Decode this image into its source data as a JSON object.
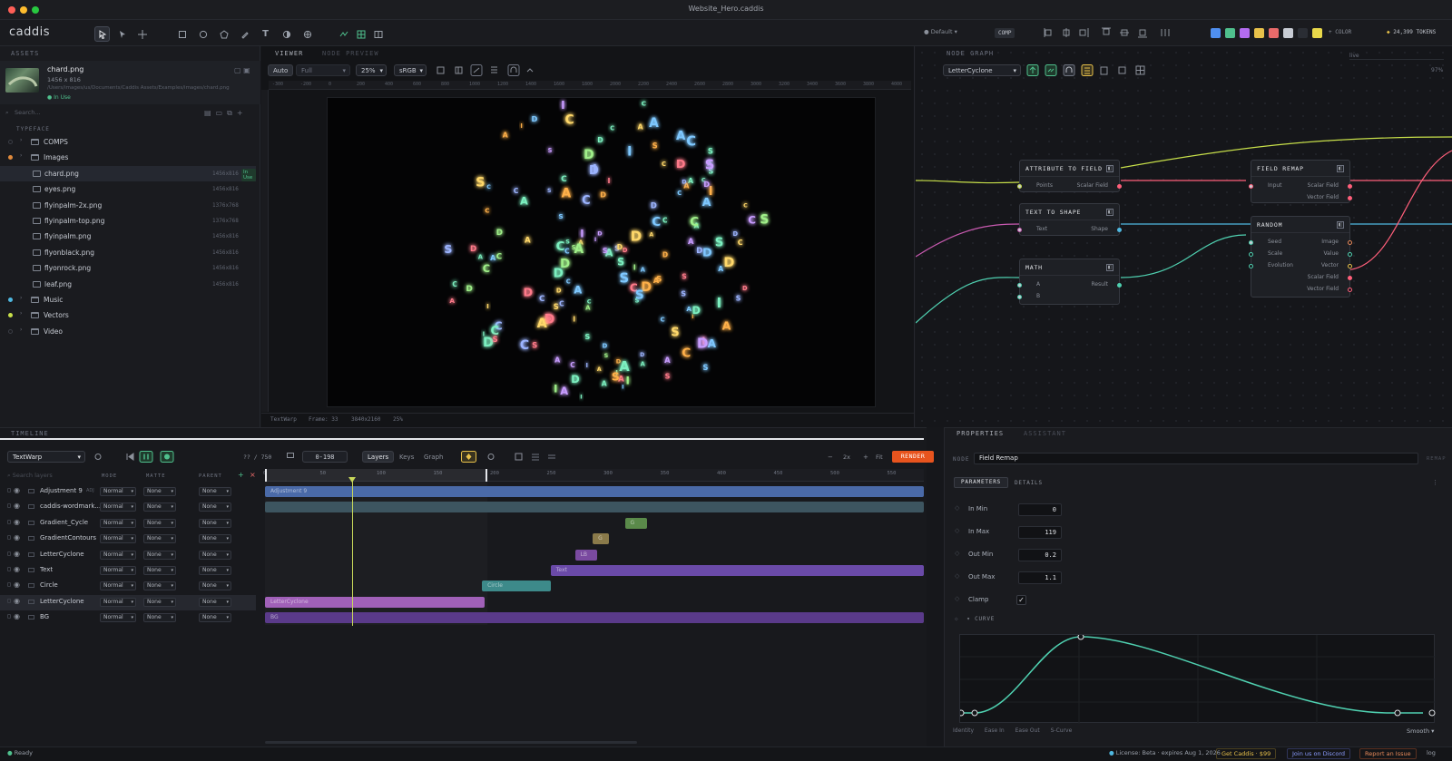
{
  "window": {
    "title": "Website_Hero.caddis"
  },
  "app": {
    "logo": "caddis"
  },
  "toolbar": {
    "tools": [
      "select-icon",
      "pointer-icon",
      "move-icon",
      "rectangle-icon",
      "ellipse-icon",
      "polygon-icon",
      "pen-icon",
      "text-icon",
      "mask-icon",
      "anchor-icon",
      "graph-icon",
      "grid-icon",
      "split-icon"
    ],
    "workspace": "Default",
    "comp_label": "COMP",
    "color_label": "+ COLOR",
    "tokens": "24,399 TOKENS",
    "swatches": [
      "#4f8ff0",
      "#4fc08d",
      "#b46cf0",
      "#e8c14a",
      "#e86a6a",
      "#c8ccd4",
      "#2a2d34",
      "#e8d84a"
    ]
  },
  "assets": {
    "header": "ASSETS",
    "preview": {
      "name": "chard.png",
      "size": "1456 x 816",
      "path": "/Users/images/us/Documents/Caddis Assets/Examples/images/chard.png",
      "status": "In Use"
    },
    "search_placeholder": "Search...",
    "section": "TYPEFACE",
    "items": [
      {
        "label": "COMPS",
        "type": "folder",
        "dot": "",
        "indent": 0
      },
      {
        "label": "Images",
        "type": "folder",
        "dot": "#e08a3c",
        "indent": 0
      },
      {
        "label": "chard.png",
        "type": "file",
        "dim": "1456x816",
        "badge": "In Use",
        "indent": 1,
        "selected": true
      },
      {
        "label": "eyes.png",
        "type": "file",
        "dim": "1456x816",
        "indent": 1
      },
      {
        "label": "flyinpalm-2x.png",
        "type": "file",
        "dim": "1376x768",
        "indent": 1
      },
      {
        "label": "flyinpalm-top.png",
        "type": "file",
        "dim": "1376x768",
        "indent": 1
      },
      {
        "label": "flyinpalm.png",
        "type": "file",
        "dim": "1456x816",
        "indent": 1
      },
      {
        "label": "flyonblack.png",
        "type": "file",
        "dim": "1456x816",
        "indent": 1
      },
      {
        "label": "flyonrock.png",
        "type": "file",
        "dim": "1456x816",
        "indent": 1
      },
      {
        "label": "leaf.png",
        "type": "file",
        "dim": "1456x816",
        "indent": 1
      },
      {
        "label": "Music",
        "type": "folder",
        "dot": "#4fb8e0",
        "indent": 0
      },
      {
        "label": "Vectors",
        "type": "folder",
        "dot": "#c8e04a",
        "indent": 0
      },
      {
        "label": "Video",
        "type": "folder",
        "dot": "",
        "indent": 0
      }
    ]
  },
  "viewer": {
    "tabs": [
      "VIEWER",
      "NODE PREVIEW"
    ],
    "controls": {
      "auto": "Auto",
      "quality": "Full",
      "zoom": "25%",
      "colorspace": "sRGB"
    },
    "ruler": [
      "-300",
      "-200",
      "0",
      "200",
      "400",
      "600",
      "800",
      "1000",
      "1200",
      "1400",
      "1600",
      "1800",
      "2000",
      "2200",
      "2400",
      "2600",
      "2800",
      "3000",
      "3200",
      "3400",
      "3600",
      "3800",
      "4000"
    ],
    "footer": {
      "comp": "TextWarp",
      "frame": "Frame: 33",
      "res": "3840x2160",
      "zoom": "25%"
    },
    "letters": "ACDISACDSACIACDSACDSACIDCSAIDSACDSAIDCACDSAICDSAISACDSAICDSACDSICASDCAIDSACDSACIDSAICDSACDSAIDSACDSACDISACDSACIDSACDSAIDCSADCIASDCAIDSACDSAICDSACDSAIDCSACDSAICDS",
    "letter_colors": [
      "#7ec8ff",
      "#ffd86a",
      "#c89cff",
      "#7cf0c0",
      "#ff7a8a",
      "#a0f08a",
      "#ffb04a",
      "#9cb4ff"
    ]
  },
  "node_graph": {
    "header": "NODE GRAPH",
    "selector": "LetterCyclone",
    "live": "live",
    "zoom": "97%",
    "nodes": {
      "attr": {
        "title": "ATTRIBUTE TO FIELD",
        "in": [
          "Points"
        ],
        "out": [
          "Scalar Field"
        ]
      },
      "text": {
        "title": "TEXT TO SHAPE",
        "in": [
          "Text"
        ],
        "out": [
          "Shape"
        ]
      },
      "math": {
        "title": "MATH",
        "in": [
          "A",
          "B"
        ],
        "out": [
          "Result"
        ]
      },
      "remap": {
        "title": "FIELD REMAP",
        "in": [
          "Input"
        ],
        "out": [
          "Scalar Field",
          "Vector Field"
        ]
      },
      "random": {
        "title": "RANDOM",
        "in": [
          "Seed",
          "Scale",
          "Evolution"
        ],
        "out": [
          "Image",
          "Value",
          "Vector",
          "Scalar Field",
          "Vector Field"
        ]
      }
    }
  },
  "timeline": {
    "header": "TIMELINE",
    "comp": "TextWarp",
    "frame": "?? / 750",
    "range": "0-198",
    "modes": [
      "Layers",
      "Keys",
      "Graph"
    ],
    "speed": "2x",
    "fit": "Fit",
    "render": "RENDER",
    "search_placeholder": "Search layers",
    "columns": [
      "MODE",
      "MATTE",
      "PARENT"
    ],
    "ticks": [
      "0",
      "50",
      "100",
      "150",
      "200",
      "250",
      "300",
      "350",
      "400",
      "450",
      "500",
      "550"
    ],
    "layers": [
      {
        "name": "Adjustment 9",
        "tag": "ADJ",
        "mode": "Normal",
        "matte": "None",
        "parent": "None"
      },
      {
        "name": "caddis-wordmark...",
        "mode": "Normal",
        "matte": "None",
        "parent": "None"
      },
      {
        "name": "Gradient_Cycle",
        "mode": "Normal",
        "matte": "None",
        "parent": "None"
      },
      {
        "name": "GradientContours",
        "mode": "Normal",
        "matte": "None",
        "parent": "None"
      },
      {
        "name": "LetterCyclone",
        "mode": "Normal",
        "matte": "None",
        "parent": "None"
      },
      {
        "name": "Text",
        "mode": "Normal",
        "matte": "None",
        "parent": "None"
      },
      {
        "name": "Circle",
        "mode": "Normal",
        "matte": "None",
        "parent": "None"
      },
      {
        "name": "LetterCyclone",
        "mode": "Normal",
        "matte": "None",
        "parent": "None",
        "selected": true
      },
      {
        "name": "BG",
        "mode": "Normal",
        "matte": "None",
        "parent": "None"
      }
    ],
    "clips": [
      {
        "label": "Adjustment 9",
        "color": "#4a6aa8"
      },
      {
        "label": "",
        "color": "#3d5560"
      },
      {
        "label": "G",
        "color": "#5a8a4a"
      },
      {
        "label": "G",
        "color": "#8a7a4a"
      },
      {
        "label": "LB",
        "color": "#7a4aa0"
      },
      {
        "label": "Text",
        "color": "#6a4aa8"
      },
      {
        "label": "Circle",
        "color": "#3d8a8a"
      },
      {
        "label": "LetterCyclone",
        "color": "#a060b8"
      },
      {
        "label": "BG",
        "color": "#5a3a8a"
      }
    ]
  },
  "properties": {
    "tabs": [
      "PROPERTIES",
      "ASSISTANT"
    ],
    "node_label": "NODE",
    "node_name": "Field Remap",
    "node_meta": "REMAP",
    "subtabs": [
      "PARAMETERS",
      "DETAILS"
    ],
    "params": [
      {
        "label": "In Min",
        "value": "0"
      },
      {
        "label": "In Max",
        "value": "119"
      },
      {
        "label": "Out Min",
        "value": "0.2"
      },
      {
        "label": "Out Max",
        "value": "1.1"
      }
    ],
    "clamp_label": "Clamp",
    "curve_label": "CURVE",
    "curve_presets": [
      "Identity",
      "Ease In",
      "Ease Out",
      "S-Curve"
    ],
    "curve_mode": "Smooth"
  },
  "status": {
    "ready": "Ready",
    "license": "License: Beta · expires Aug 1, 2026",
    "get": "Get Caddis · $99",
    "discord": "Join us on Discord",
    "report": "Report an Issue",
    "log": "log"
  }
}
